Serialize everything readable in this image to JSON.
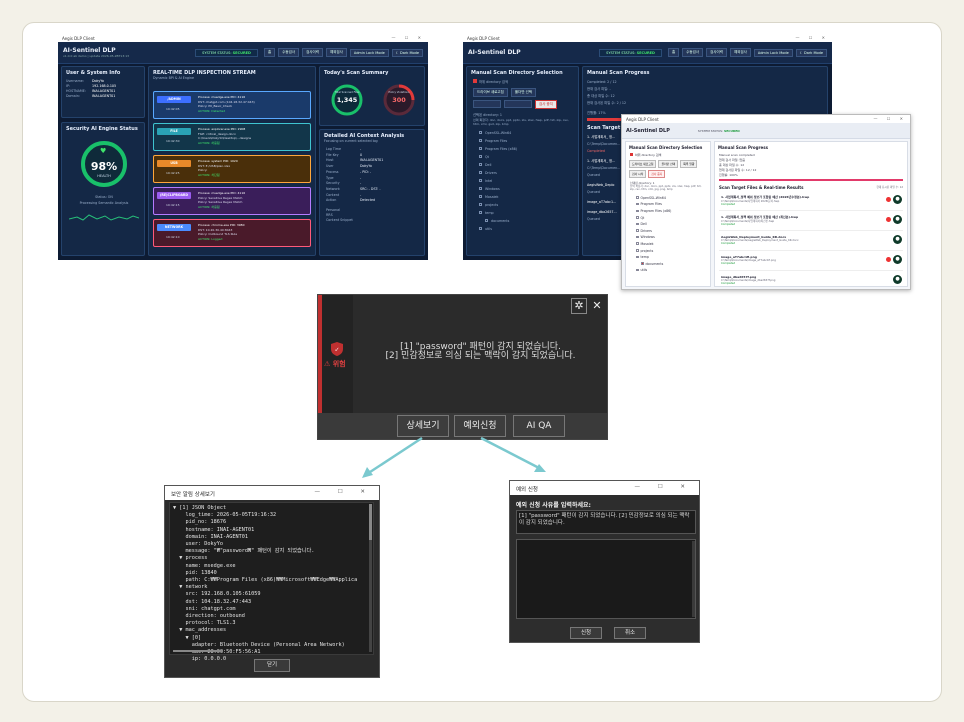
{
  "topleft": {
    "title": "Aegis DLP Client",
    "brand": "AI-Sentinel DLP",
    "ver": "v1.0.0 ab demo | update 2026-05-2BT13:13",
    "status_label": "SYSTEM STATUS:",
    "status": "SECURED",
    "buttons": [
      "홈",
      "수동검사",
      "검사이력",
      "예외검사",
      "Admin Lock Mode",
      "☾ Dark Mode"
    ],
    "user_title": "User & System Info",
    "user_rows": [
      "Username:",
      "DokyYo",
      "IP:",
      "192.168.0.105",
      "HOSTNAME:",
      "INAI-AGENT01",
      "Domain:",
      "INAI-AGENT01"
    ],
    "engine_title": "Security AI Engine Status",
    "health": "98%",
    "health_label": "HEALTH",
    "engine_status": "Status: ON",
    "engine_sub": "Processing Semantic Analysis",
    "stream_title": "REAL-TIME DLP INSPECTION STREAM",
    "stream_sub": "Dynamic BPI & AI Engine",
    "events": [
      {
        "tag": "/ADMIN",
        "time": "19:42:05",
        "l1": "Process: msedge.exe   PID: 4116",
        "l2": "DST: chatgpt.com (104.18.32.47:443)",
        "l3": "Policy: PII_Basic_Check",
        "l4": "ACTION: Detected"
      },
      {
        "tag": "FILE",
        "time": "19:42:30",
        "l1": "Process: explorer.exe   PID: 2908",
        "l2": "FILE: critical_design.docx",
        "l3": "C:\\Users\\DokyYo\\Desktop\\...designs",
        "l4": "ACTION: 허용됨"
      },
      {
        "tag": "USB",
        "time": "19:42:25",
        "l1": "Process: system   PID: 1020",
        "l2": "DST: E:/USB/plan.xlsx",
        "l3": "Policy:",
        "l4": "ACTION: 차단됨"
      },
      {
        "tag": "(RE)CLIPBOARD",
        "time": "19:42:15",
        "l1": "Process: msedge.exe   PID: 4116",
        "l2": "Policy: Sensitive Regex Match",
        "l3": "Policy: Sensitive Regex Match",
        "l4": "ACTION: 허용됨"
      },
      {
        "tag": "NETWORK",
        "time": "19:42:10",
        "l1": "Process: chrome.exe   PID: 3980",
        "l2": "DST: 10.20.30.40:8443",
        "l3": "Policy: Outbound TLS Rule",
        "l4": "ACTION: Logged"
      }
    ],
    "summary_title": "Today's Scan Summary",
    "total": "1,345",
    "total_label": "Total Scanned Files",
    "violations": "300",
    "violations_label": "Policy Violations",
    "context_title": "Detailed AI Context Analysis",
    "context_sub": "Focusing on current selected log",
    "context_rows": [
      "Log Time",
      "-",
      "File Key",
      "0",
      "Host",
      "INAI-AGENT01",
      "User",
      "DokyYo",
      "Process",
      "- PID: -",
      "Type",
      "-",
      "Security",
      "-",
      "Network",
      "SRC: -  DST: -",
      "Content",
      "-",
      "Action",
      "Detected"
    ],
    "context_foot": [
      "Personal",
      "RRS",
      "Content Snippet"
    ]
  },
  "topright": {
    "title": "Aegis DLP Client",
    "brand": "AI-Sentinel DLP",
    "status_label": "SYSTEM STATUS:",
    "status": "SECURED",
    "buttons": [
      "홈",
      "수동검사",
      "검사이력",
      "예외검사",
      "Admin Lock Mode",
      "☾ Dark Mode"
    ],
    "dir_title": "Manual Scan Directory Selection",
    "checkbox": "하위 directory 검색",
    "dir_btns": [
      "드라이브 새로고침",
      "폴더만 선택",
      "",
      ""
    ],
    "dir_btn_red": "검사 중지",
    "dir_label": "선택된 directory: 1",
    "dir_ext": "선택 확장자: doc, docx, ppt, pptx, xls, xlsx, hwp, pdf, txt, zip, csv, htm, xml, gsd, zip, bmp",
    "tree": [
      "OpenSSL-Win64",
      "Program Files",
      "Program Files (x86)",
      "Qt",
      "Dell",
      "Drivers",
      "Intel",
      "Windows",
      "Mosaiek",
      "projects",
      "temp",
      "documents",
      "utils"
    ],
    "progress_title": "Manual Scan Progress",
    "completed": "Completed: 2 / 12",
    "cur": "현재 검사 파일: -",
    "total": "총 대상 파일 수: 12",
    "done": "현재 검사된 파일 수: 2 / 12",
    "prog": "진행률: 17%",
    "target_title": "Scan Target Fi",
    "rows": [
      "1. 사업계획서_ 정...",
      "C:\\Temp\\Documen...",
      "Completed",
      "1. 사업계획서_ 정...",
      "C:\\Temp\\Documen...",
      "Queued",
      "AegisWeb_Deplo",
      "Queued",
      "image_aT7abc1...",
      "image_dba2657...",
      "Queued"
    ]
  },
  "overlay": {
    "title": "Aegis DLP Client",
    "brand": "AI-Sentinel DLP",
    "status_label": "SYSTEM STATUS:",
    "status": "SECURED",
    "dir_title": "Manual Scan Directory Selection",
    "checkbox": "하위 directory 검색",
    "btns": [
      "드라이브 새로고침",
      "폴더만 선택",
      "목록 열람",
      "검사 시작",
      "검사 중지"
    ],
    "dir_label": "선택된 directory: 1",
    "dir_ext": "선택 확장자: doc, docx, ppt, pptx, xls, xlsx, hwp, pdf, txt, zip, csv, htm, xml, jpg, png, bmp",
    "tree": [
      "OpenSSL-Win64",
      "Program Files",
      "Program Files (x86)",
      "Qt",
      "Dell",
      "Drivers",
      "Windows",
      "Mosaiek",
      "projects",
      "temp",
      "documents",
      "utils"
    ],
    "progress_title": "Manual Scan Progress",
    "p1": "Manual scan completed",
    "p2": "현재 검사 파일: 없음",
    "p3": "총 대상 파일 수: 12",
    "p4": "현재 검사된 파일 수: 12 / 12",
    "p5": "진행률: 100%",
    "results_title": "Scan Target Files & Real-time Results",
    "results_count": "현재 표시된 파일 수: 12",
    "results": [
      {
        "t": "1. 사업계획서_정책 예외 정보가 포함된 예산 (2026년수정본).hwp",
        "p": "C:\\Temp\\Documents\\사업계획서 2026\\문서.hwp",
        "s": "Completed"
      },
      {
        "t": "1. 사업계획서_정책 예외 정보가 포함된 예산 (최신본).hwp",
        "p": "C:\\Temp\\Documents\\사업계획서\\최신본.hwp",
        "s": "Completed"
      },
      {
        "t": "AegisWeb_Deployment_Guide_KR.docx",
        "p": "C:\\Temp\\Documents\\AegisWeb_Deployment_Guide_KR.docx",
        "s": "Completed"
      },
      {
        "t": "image_aT7abc1fi.png",
        "p": "C:\\Temp\\Documents\\image_aT7abc1fi.png",
        "s": "Completed"
      },
      {
        "t": "image_dba2657f.png",
        "p": "C:\\Temp\\Documents\\image_dba2657f.png",
        "s": "Completed"
      }
    ]
  },
  "popup": {
    "message_line1": "[1] \"password\" 패턴이 감지 되었습니다.",
    "message_line2": "[2] 민감정보로 의심 되는 맥락이 감지 되었습니다.",
    "risk": "⚠ 위험",
    "buttons": [
      "상세보기",
      "예외신청",
      "AI QA"
    ]
  },
  "detail": {
    "title": "보안 알림 상세보기",
    "close_btn": "닫기",
    "lines": [
      "▼ [1] JSON Object",
      "    log_time: 2026-05-05T19:16:32",
      "    pid_no: 18676",
      "    hostname: INAI-AGENT01",
      "    domain: INAI-AGENT01",
      "    user: DokyYo",
      "    message: \"₩\"password₩\" 패턴이 감지 되었습니다.",
      "  ▼ process",
      "    name: msedge.exe",
      "    pid: 13840",
      "    path: C:₩₩Program Files (x86)₩₩Microsoft₩₩Edge₩₩Applica",
      "  ▼ network",
      "    src: 192.168.0.105:61059",
      "    dst: 104.18.32.47:443",
      "    sni: chatgpt.com",
      "    direction: outbound",
      "    protocol: TLS1.3",
      "  ▼ mac_addresses",
      "    ▼ [0]",
      "      adapter: Bluetooth Device (Personal Area Network)",
      "      mac: 28:0C:50:F5:56:A1",
      "      ip: 0.0.0.0"
    ]
  },
  "exception": {
    "title": "예외 신청",
    "prompt": "예외 신청 사유를 입력하세요:",
    "quote": "[1] \"password\" 패턴이 감지 되었습니다. [2] 민감정보로 의심 되는 맥락이 감지 되었습니다.",
    "submit": "신청",
    "cancel": "취소"
  }
}
